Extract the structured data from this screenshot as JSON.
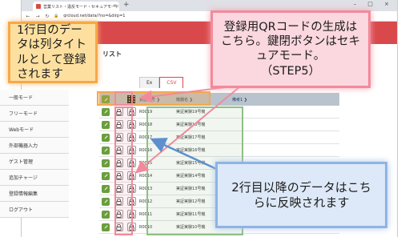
{
  "browser": {
    "tab_title": "営業リスト・違反モード・セキュアモード",
    "url": "qrcloud.net/data/?no=&dirp=1",
    "new_tab": "+",
    "window_controls": "– □ ×"
  },
  "page": {
    "title_suffix": "リスト"
  },
  "sidebar": {
    "items": [
      {
        "label": "一般モード"
      },
      {
        "label": "フリーモード"
      },
      {
        "label": "Webモード"
      },
      {
        "label": "外部機器入力"
      },
      {
        "label": "ゲスト管理"
      },
      {
        "label": "追加チャージ"
      },
      {
        "label": "登録情報編集"
      },
      {
        "label": "ログアウト"
      }
    ]
  },
  "tabs": [
    {
      "label": "Ex",
      "active": false
    },
    {
      "label": "CSV",
      "active": true
    }
  ],
  "table": {
    "headers": [
      "資産番号 ❯",
      "機器名 ❯",
      "備考1 ❯"
    ],
    "rows": [
      {
        "id": "R0019",
        "model": "実証実験19号機"
      },
      {
        "id": "R0018",
        "model": "実証実験18号機"
      },
      {
        "id": "R0017",
        "model": "実証実験17号機"
      },
      {
        "id": "R0016",
        "model": "実証実験16号機"
      },
      {
        "id": "R0015",
        "model": "実証実験15号機"
      },
      {
        "id": "R0014",
        "model": "実証実験14号機"
      },
      {
        "id": "R0013",
        "model": "実証実験13号機"
      },
      {
        "id": "R0012",
        "model": "実証実験12号機"
      },
      {
        "id": "R0011",
        "model": "実証実験11号機"
      },
      {
        "id": "R0010",
        "model": "実証実験10号機"
      }
    ]
  },
  "callouts": {
    "left": "1行目のデータは列タイトルとして登録されます",
    "top_line1": "登録用QRコードの生成はこちら。鍵閉ボタンはセキュアモード。",
    "top_step": "（STEP5）",
    "right": "2行目以降のデータはこちらに反映されます"
  },
  "colors": {
    "header_red": "#d9484a",
    "callout_orange": "#f6a848",
    "callout_pink": "#f28a9b",
    "callout_blue": "#8fb3e3",
    "highlight_green": "#8fbf84"
  }
}
